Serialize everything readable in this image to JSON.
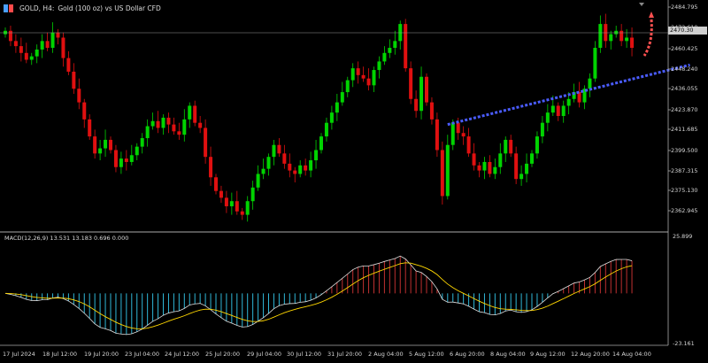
{
  "header": {
    "symbol": "GOLD, H4:",
    "description": "Gold (100 oz) vs US Dollar CFD"
  },
  "price_axis": {
    "labels": [
      "2484.795",
      "2472.610",
      "2460.425",
      "2448.240",
      "2436.055",
      "2423.870",
      "2411.685",
      "2399.500",
      "2387.315",
      "2375.130",
      "2362.945"
    ],
    "current_price": "2470.30"
  },
  "macd": {
    "label": "MACD(12,26,9) 13.531 13.183 0.696 0.000",
    "axis_top": "25.899",
    "axis_bottom": "-23.161"
  },
  "time_axis": {
    "labels": [
      "17 Jul 2024",
      "18 Jul 12:00",
      "19 Jul 20:00",
      "23 Jul 04:00",
      "24 Jul 12:00",
      "25 Jul 20:00",
      "29 Jul 04:00",
      "30 Jul 12:00",
      "31 Jul 20:00",
      "2 Aug 04:00",
      "5 Aug 12:00",
      "6 Aug 20:00",
      "8 Aug 04:00",
      "9 Aug 12:00",
      "12 Aug 20:00",
      "14 Aug 04:00"
    ]
  },
  "colors": {
    "bull": "#00d400",
    "bear": "#e01010",
    "trendline": "#4a5cff",
    "arrow": "#ff5050",
    "signal": "#ffd700",
    "macd_line": "#e0e0e0",
    "hist_pos": "#c03030",
    "hist_neg": "#30b8d8"
  },
  "chart_data": {
    "type": "candlestick",
    "price_range": [
      2356,
      2488
    ],
    "closes": [
      2472,
      2466,
      2463,
      2459,
      2455,
      2457,
      2461,
      2466,
      2462,
      2471,
      2468,
      2456,
      2448,
      2438,
      2430,
      2420,
      2410,
      2400,
      2403,
      2408,
      2402,
      2392,
      2397,
      2395,
      2399,
      2404,
      2409,
      2416,
      2419,
      2415,
      2421,
      2417,
      2413,
      2411,
      2420,
      2428,
      2418,
      2415,
      2398,
      2386,
      2378,
      2374,
      2369,
      2372,
      2366,
      2364,
      2372,
      2380,
      2388,
      2391,
      2398,
      2405,
      2400,
      2394,
      2390,
      2388,
      2393,
      2390,
      2396,
      2402,
      2410,
      2418,
      2424,
      2430,
      2436,
      2443,
      2450,
      2446,
      2444,
      2440,
      2449,
      2454,
      2459,
      2462,
      2466,
      2476,
      2450,
      2432,
      2425,
      2445,
      2430,
      2420,
      2402,
      2375,
      2405,
      2418,
      2412,
      2410,
      2400,
      2393,
      2390,
      2395,
      2388,
      2392,
      2400,
      2408,
      2400,
      2385,
      2388,
      2394,
      2400,
      2410,
      2418,
      2424,
      2428,
      2422,
      2428,
      2432,
      2436,
      2430,
      2438,
      2444,
      2462,
      2476,
      2466,
      2470,
      2472,
      2466,
      2468,
      2462
    ],
    "opens": [
      2470,
      2472,
      2466,
      2463,
      2459,
      2455,
      2457,
      2461,
      2466,
      2462,
      2471,
      2468,
      2456,
      2448,
      2438,
      2430,
      2420,
      2410,
      2400,
      2403,
      2408,
      2402,
      2392,
      2397,
      2395,
      2399,
      2404,
      2409,
      2416,
      2419,
      2415,
      2421,
      2417,
      2413,
      2411,
      2420,
      2428,
      2418,
      2415,
      2398,
      2386,
      2378,
      2374,
      2369,
      2372,
      2366,
      2364,
      2372,
      2380,
      2388,
      2391,
      2398,
      2405,
      2400,
      2394,
      2390,
      2388,
      2393,
      2390,
      2396,
      2402,
      2410,
      2418,
      2424,
      2430,
      2436,
      2443,
      2450,
      2446,
      2444,
      2440,
      2449,
      2454,
      2459,
      2462,
      2466,
      2476,
      2450,
      2432,
      2425,
      2445,
      2430,
      2420,
      2402,
      2375,
      2405,
      2418,
      2412,
      2410,
      2400,
      2393,
      2390,
      2395,
      2388,
      2392,
      2400,
      2408,
      2400,
      2385,
      2388,
      2394,
      2400,
      2410,
      2418,
      2424,
      2428,
      2422,
      2428,
      2432,
      2436,
      2430,
      2438,
      2444,
      2462,
      2476,
      2466,
      2470,
      2472,
      2466,
      2468
    ],
    "trendline": {
      "from": {
        "index": 84,
        "price": 2417
      },
      "to": {
        "index": 130,
        "price": 2452
      }
    },
    "macd_range": [
      -23.161,
      25.899
    ]
  }
}
